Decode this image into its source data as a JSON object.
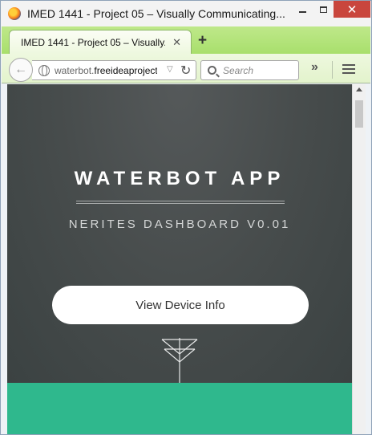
{
  "window": {
    "title": "IMED 1441 - Project 05 – Visually Communicating...",
    "close_glyph": "✕"
  },
  "tabs": [
    {
      "label": "IMED 1441 - Project 05 – Visually...",
      "close_glyph": "✕"
    }
  ],
  "toolbar": {
    "new_tab_glyph": "+",
    "back_glyph": "←",
    "url_prefix": "waterbot.",
    "url_domain": "freeideaproject.",
    "url_dropdown_glyph": "▽",
    "reload_glyph": "↻",
    "search_placeholder": "Search",
    "overflow_glyph": "»"
  },
  "page": {
    "app_title": "WATERBOT APP",
    "subtitle": "NERITES DASHBOARD V0.01",
    "button_label": "View Device Info"
  },
  "colors": {
    "hero_bg": "#474c4c",
    "accent_green": "#2fb88d",
    "tab_strip": "#b4e37a",
    "close_button": "#c9463d"
  },
  "icons": {
    "app": "firefox-icon",
    "back": "back-arrow-icon",
    "site": "globe-icon",
    "search": "search-icon",
    "menu": "hamburger-menu-icon",
    "scroll_cue": "down-chevron-arrow-icon"
  }
}
